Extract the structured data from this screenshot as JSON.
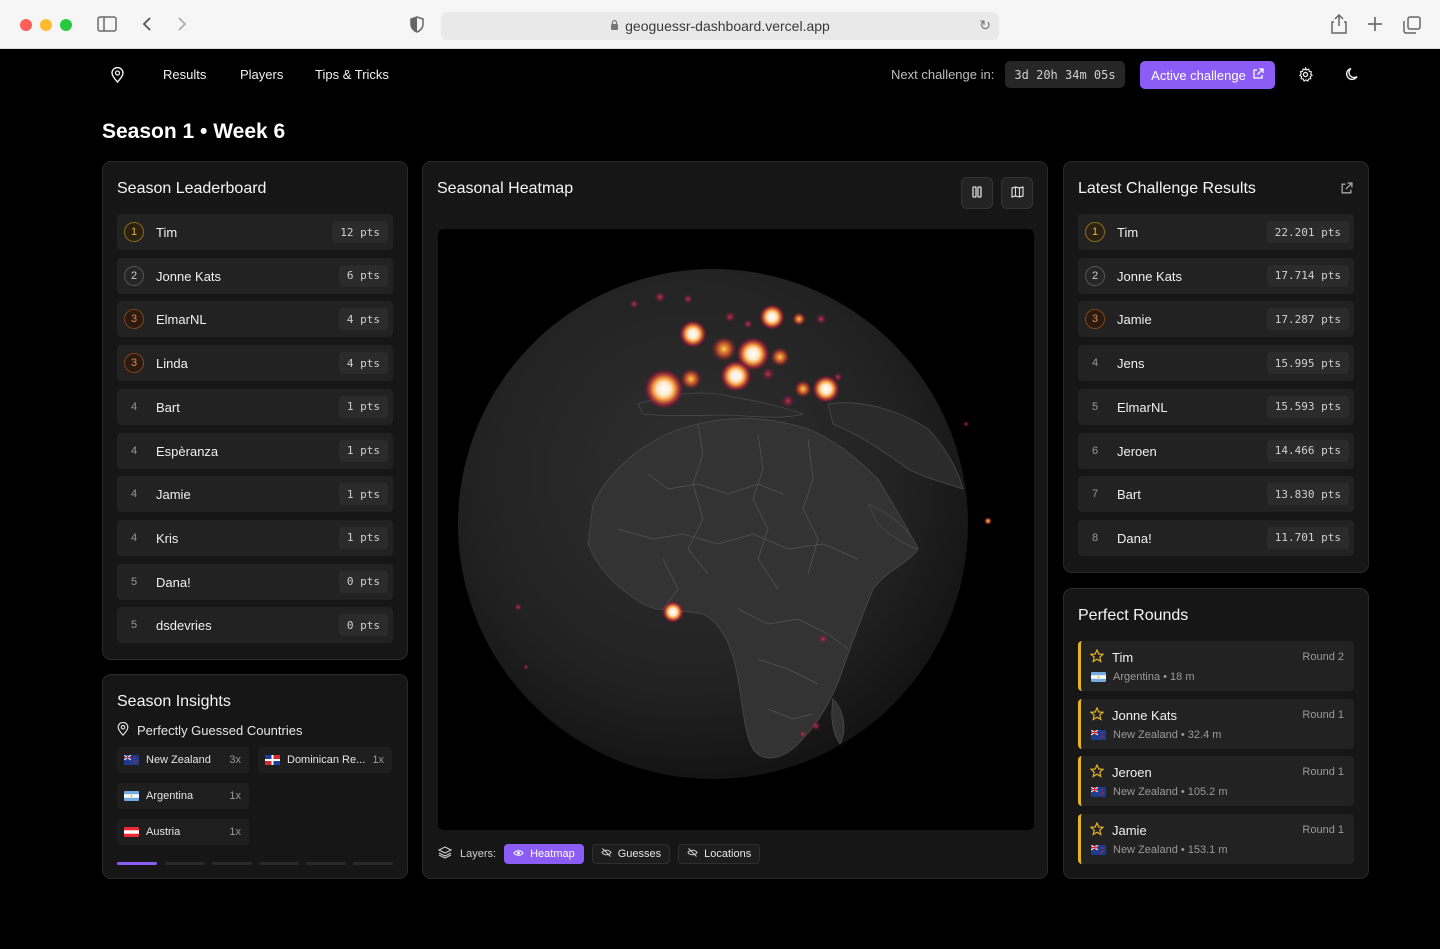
{
  "browser": {
    "url": "geoguessr-dashboard.vercel.app"
  },
  "nav": {
    "items": [
      "Results",
      "Players",
      "Tips & Tricks"
    ],
    "countdown_label": "Next challenge in:",
    "countdown_value": "3d 20h 34m 05s",
    "active_challenge_label": "Active challenge",
    "accent_color": "#8b5cf6"
  },
  "page_title": "Season 1 • Week 6",
  "leaderboard": {
    "title": "Season Leaderboard",
    "rows": [
      {
        "rank": "1",
        "name": "Tim",
        "pts": "12 pts",
        "medal": "gold"
      },
      {
        "rank": "2",
        "name": "Jonne Kats",
        "pts": "6 pts",
        "medal": "silver"
      },
      {
        "rank": "3",
        "name": "ElmarNL",
        "pts": "4 pts",
        "medal": "bronze"
      },
      {
        "rank": "3",
        "name": "Linda",
        "pts": "4 pts",
        "medal": "bronze"
      },
      {
        "rank": "4",
        "name": "Bart",
        "pts": "1 pts",
        "medal": "plain"
      },
      {
        "rank": "4",
        "name": "Espèranza",
        "pts": "1 pts",
        "medal": "plain"
      },
      {
        "rank": "4",
        "name": "Jamie",
        "pts": "1 pts",
        "medal": "plain"
      },
      {
        "rank": "4",
        "name": "Kris",
        "pts": "1 pts",
        "medal": "plain"
      },
      {
        "rank": "5",
        "name": "Dana!",
        "pts": "0 pts",
        "medal": "plain"
      },
      {
        "rank": "5",
        "name": "dsdevries",
        "pts": "0 pts",
        "medal": "plain"
      }
    ]
  },
  "insights": {
    "title": "Season Insights",
    "subtitle": "Perfectly Guessed Countries",
    "countries": [
      {
        "name": "New Zealand",
        "count": "3x",
        "flag": "nz"
      },
      {
        "name": "Dominican Re...",
        "count": "1x",
        "flag": "do"
      },
      {
        "name": "Argentina",
        "count": "1x",
        "flag": "ar"
      },
      {
        "name": "Austria",
        "count": "1x",
        "flag": "at"
      }
    ]
  },
  "heatmap": {
    "title": "Seasonal Heatmap",
    "layers_label": "Layers:",
    "layers": [
      {
        "label": "Heatmap",
        "active": true
      },
      {
        "label": "Guesses",
        "active": false
      },
      {
        "label": "Locations",
        "active": false
      }
    ]
  },
  "latest": {
    "title": "Latest Challenge Results",
    "rows": [
      {
        "rank": "1",
        "name": "Tim",
        "pts": "22.201 pts",
        "medal": "gold"
      },
      {
        "rank": "2",
        "name": "Jonne Kats",
        "pts": "17.714 pts",
        "medal": "silver"
      },
      {
        "rank": "3",
        "name": "Jamie",
        "pts": "17.287 pts",
        "medal": "bronze"
      },
      {
        "rank": "4",
        "name": "Jens",
        "pts": "15.995 pts",
        "medal": "plain"
      },
      {
        "rank": "5",
        "name": "ElmarNL",
        "pts": "15.593 pts",
        "medal": "plain"
      },
      {
        "rank": "6",
        "name": "Jeroen",
        "pts": "14.466 pts",
        "medal": "plain"
      },
      {
        "rank": "7",
        "name": "Bart",
        "pts": "13.830 pts",
        "medal": "plain"
      },
      {
        "rank": "8",
        "name": "Dana!",
        "pts": "11.701 pts",
        "medal": "plain"
      }
    ]
  },
  "perfect": {
    "title": "Perfect Rounds",
    "rows": [
      {
        "name": "Tim",
        "detail": "Argentina • 18 m",
        "round": "Round 2",
        "flag": "ar"
      },
      {
        "name": "Jonne Kats",
        "detail": "New Zealand • 32.4 m",
        "round": "Round 1",
        "flag": "nz"
      },
      {
        "name": "Jeroen",
        "detail": "New Zealand • 105.2 m",
        "round": "Round 1",
        "flag": "nz"
      },
      {
        "name": "Jamie",
        "detail": "New Zealand • 153.1 m",
        "round": "Round 1",
        "flag": "nz"
      }
    ]
  }
}
